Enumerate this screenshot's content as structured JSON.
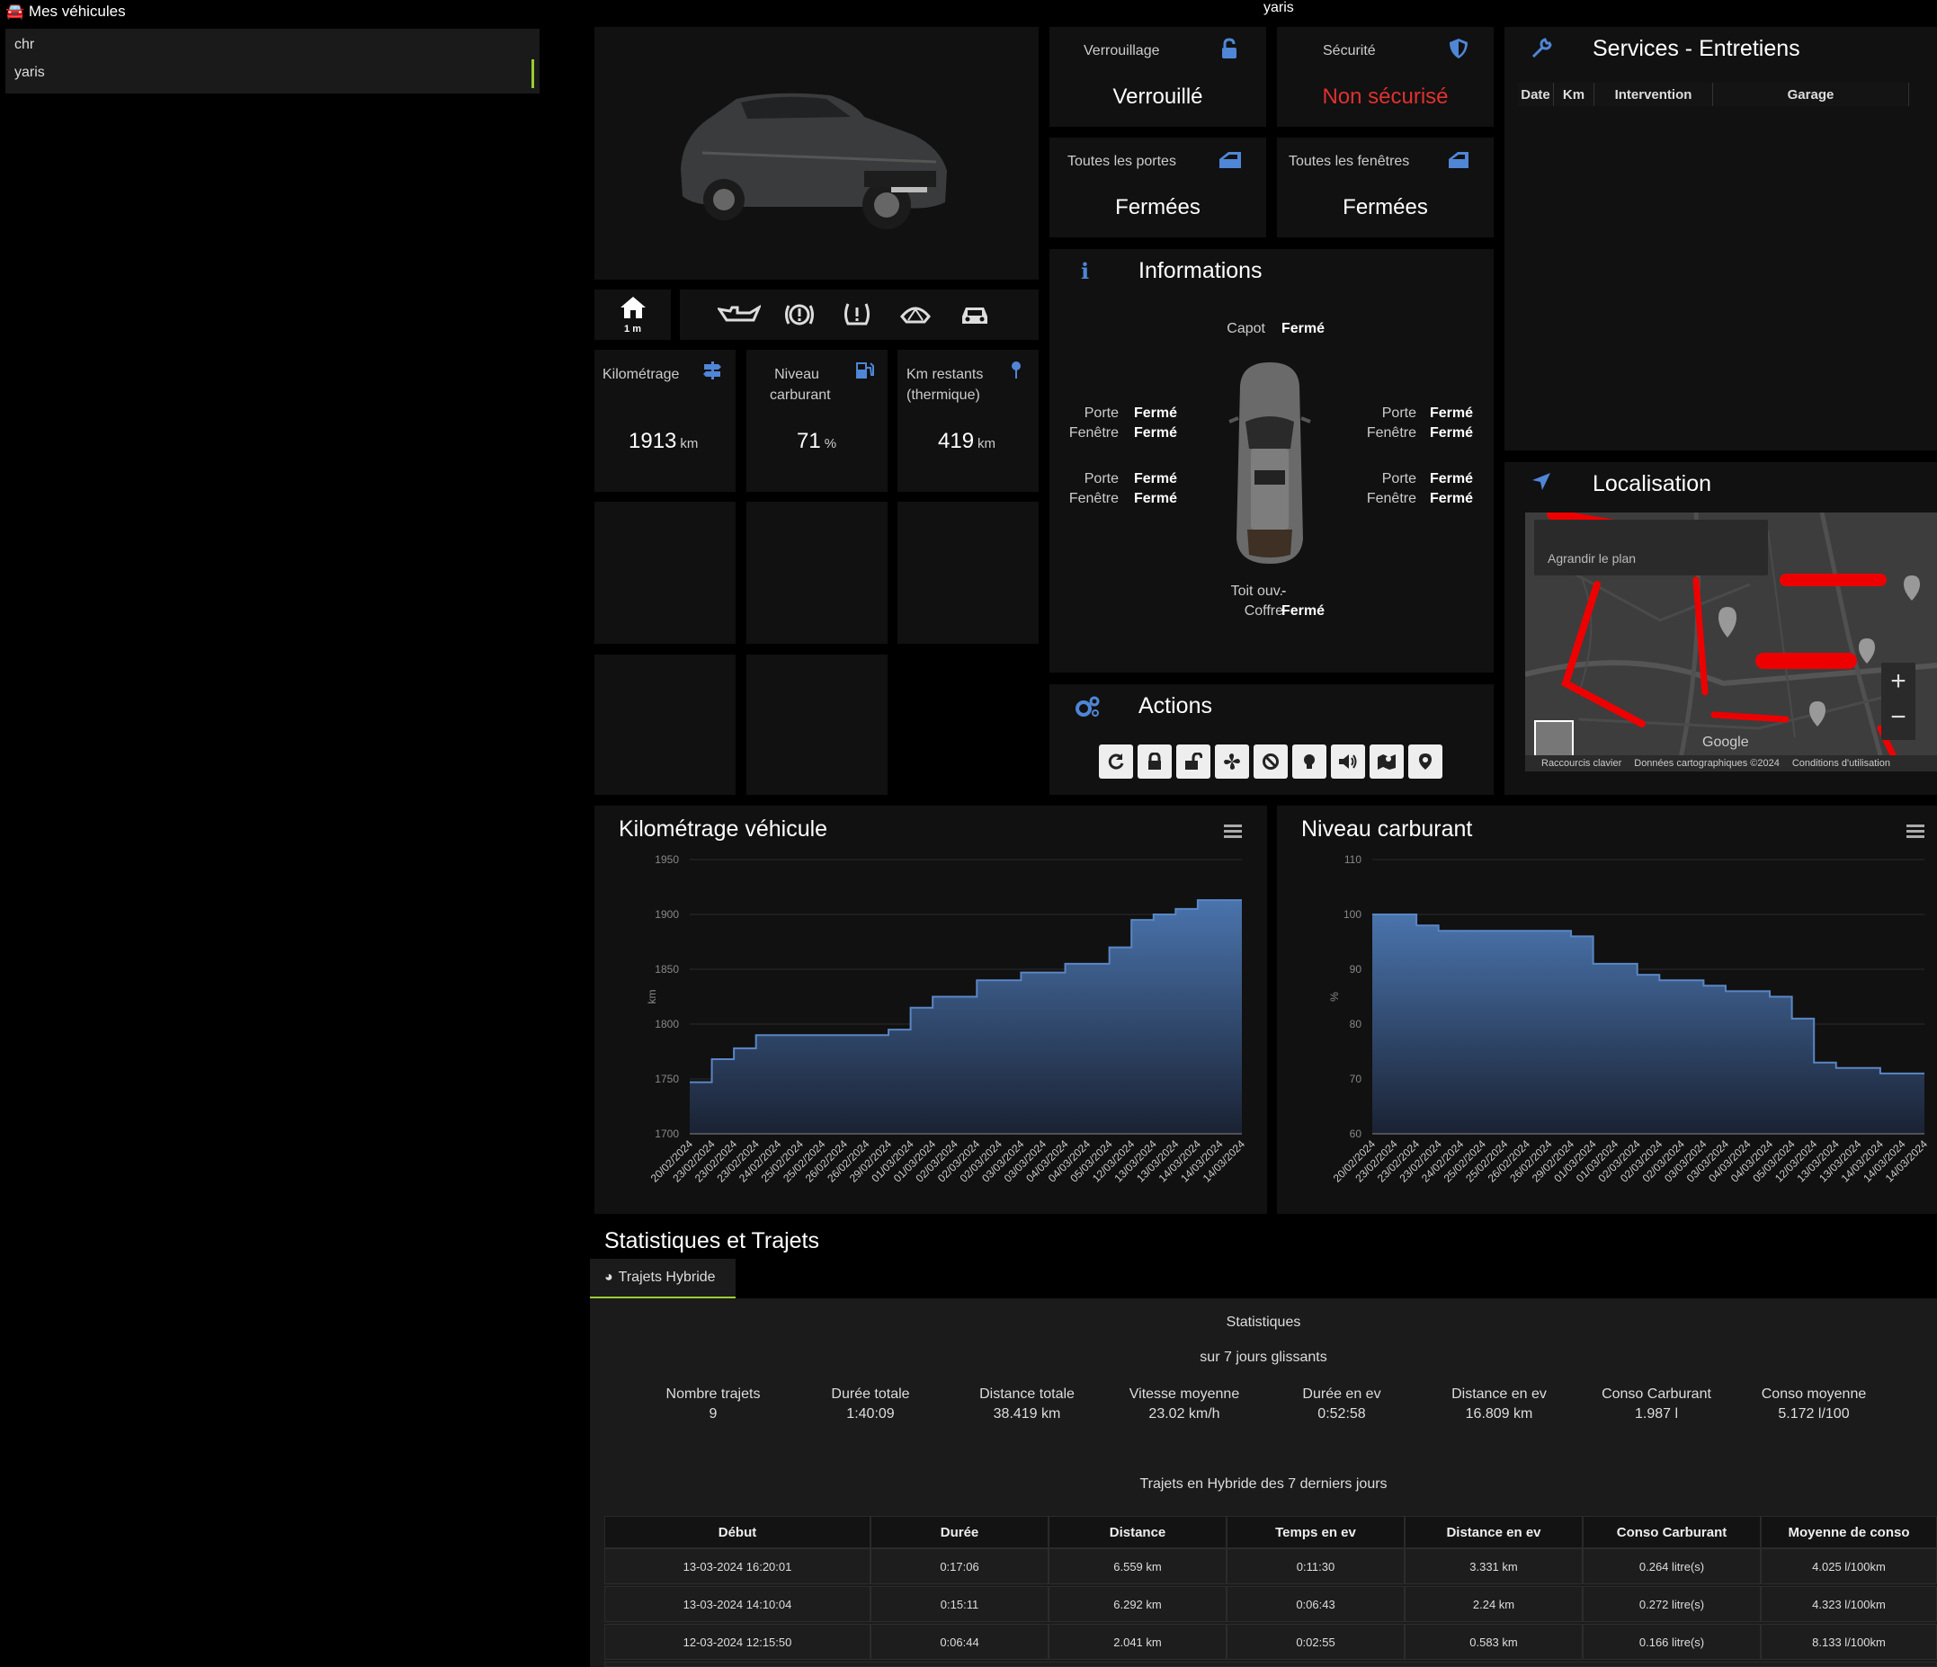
{
  "sidebar": {
    "title": "Mes véhicules",
    "items": [
      {
        "label": "chr"
      },
      {
        "label": "yaris"
      }
    ],
    "selected": "yaris"
  },
  "header": {
    "vehicle_name": "yaris"
  },
  "status": {
    "lock": {
      "title": "Verrouillage",
      "value": "Verrouillé",
      "icon": "lock-open-icon"
    },
    "security": {
      "title": "Sécurité",
      "value": "Non sécurisé",
      "icon": "shield-icon",
      "color": "#e0312f"
    },
    "doors": {
      "title": "Toutes les portes",
      "value": "Fermées",
      "icon": "car-door-icon"
    },
    "windows": {
      "title": "Toutes les fenêtres",
      "value": "Fermées",
      "icon": "car-window-icon"
    }
  },
  "location_badge": {
    "label": "1 m",
    "icon": "home-icon"
  },
  "warning_icons": [
    "oil-warning-icon",
    "brake-warning-icon",
    "tire-pressure-icon",
    "washer-fluid-icon",
    "car-icon"
  ],
  "tiles": {
    "mileage": {
      "title": "Kilométrage",
      "value": "1913",
      "unit": "km",
      "icon": "signpost-icon"
    },
    "fuel": {
      "title_line1": "Niveau",
      "title_line2": "carburant",
      "value": "71",
      "unit": "%",
      "icon": "fuel-pump-icon"
    },
    "range": {
      "title_line1": "Km restants",
      "title_line2": "(thermique)",
      "value": "419",
      "unit": "km",
      "icon": "map-pin-icon"
    }
  },
  "informations": {
    "title": "Informations",
    "hood": {
      "label": "Capot",
      "value": "Fermé"
    },
    "front_left": {
      "door_label": "Porte",
      "door_value": "Fermé",
      "window_label": "Fenêtre",
      "window_value": "Fermé"
    },
    "front_right": {
      "door_label": "Porte",
      "door_value": "Fermé",
      "window_label": "Fenêtre",
      "window_value": "Fermé"
    },
    "rear_left": {
      "door_label": "Porte",
      "door_value": "Fermé",
      "window_label": "Fenêtre",
      "window_value": "Fermé"
    },
    "rear_right": {
      "door_label": "Porte",
      "door_value": "Fermé",
      "window_label": "Fenêtre",
      "window_value": "Fermé"
    },
    "roof": {
      "label": "Toit ouv.",
      "value": "-"
    },
    "trunk": {
      "label": "Coffre",
      "value": "Fermé"
    }
  },
  "actions": {
    "title": "Actions",
    "buttons": [
      "refresh-icon",
      "lock-icon",
      "unlock-icon",
      "fan-icon",
      "ban-icon",
      "lightbulb-icon",
      "horn-icon",
      "map-icon",
      "pin-icon"
    ]
  },
  "services": {
    "title": "Services - Entretiens",
    "columns": [
      "Date",
      "Km",
      "Intervention",
      "Garage"
    ]
  },
  "localisation": {
    "title": "Localisation",
    "enlarge": "Agrandir le plan",
    "google": "Google",
    "footer": [
      "Raccourcis clavier",
      "Données cartographiques ©2024",
      "Conditions d'utilisation"
    ]
  },
  "charts": {
    "mileage": {
      "title": "Kilométrage véhicule",
      "ylabel": "km",
      "ylim": [
        1700,
        1950
      ],
      "yticks": [
        "1700",
        "1750",
        "1800",
        "1850",
        "1900",
        "1950"
      ]
    },
    "fuel": {
      "title": "Niveau carburant",
      "ylabel": "%",
      "ylim": [
        60,
        110
      ],
      "yticks": [
        "60",
        "70",
        "80",
        "90",
        "100",
        "110"
      ]
    }
  },
  "chart_data": [
    {
      "type": "area",
      "title": "Kilométrage véhicule",
      "ylabel": "km",
      "ylim": [
        1700,
        1950
      ],
      "color": "#4a74ad",
      "x": [
        "20/02/2024",
        "23/02/2024",
        "23/02/2024",
        "23/02/2024",
        "24/02/2024",
        "25/02/2024",
        "25/02/2024",
        "26/02/2024",
        "26/02/2024",
        "29/02/2024",
        "01/03/2024",
        "01/03/2024",
        "02/03/2024",
        "02/03/2024",
        "02/03/2024",
        "03/03/2024",
        "03/03/2024",
        "04/03/2024",
        "04/03/2024",
        "05/03/2024",
        "12/03/2024",
        "13/03/2024",
        "13/03/2024",
        "14/03/2024",
        "14/03/2024",
        "14/03/2024"
      ],
      "values": [
        1747,
        1768,
        1778,
        1790,
        1790,
        1790,
        1790,
        1790,
        1790,
        1795,
        1815,
        1825,
        1825,
        1840,
        1840,
        1847,
        1847,
        1855,
        1855,
        1870,
        1895,
        1900,
        1905,
        1913,
        1913,
        1913
      ]
    },
    {
      "type": "area",
      "title": "Niveau carburant",
      "ylabel": "%",
      "ylim": [
        60,
        110
      ],
      "color": "#4a74ad",
      "x": [
        "20/02/2024",
        "23/02/2024",
        "23/02/2024",
        "23/02/2024",
        "24/02/2024",
        "25/02/2024",
        "25/02/2024",
        "26/02/2024",
        "26/02/2024",
        "29/02/2024",
        "01/03/2024",
        "01/03/2024",
        "02/03/2024",
        "02/03/2024",
        "02/03/2024",
        "03/03/2024",
        "03/03/2024",
        "04/03/2024",
        "04/03/2024",
        "05/03/2024",
        "12/03/2024",
        "13/03/2024",
        "13/03/2024",
        "14/03/2024",
        "14/03/2024",
        "14/03/2024"
      ],
      "values": [
        100,
        100,
        98,
        97,
        97,
        97,
        97,
        97,
        97,
        96,
        91,
        91,
        89,
        88,
        88,
        87,
        86,
        86,
        85,
        81,
        73,
        72,
        72,
        71,
        71,
        71
      ]
    }
  ],
  "statistics": {
    "section_title": "Statistiques et Trajets",
    "tab": "Trajets Hybride",
    "heading": "Statistiques",
    "period": "sur 7 jours glissants",
    "items": [
      {
        "label": "Nombre trajets",
        "value": "9"
      },
      {
        "label": "Durée totale",
        "value": "1:40:09"
      },
      {
        "label": "Distance totale",
        "value": "38.419 km"
      },
      {
        "label": "Vitesse moyenne",
        "value": "23.02 km/h"
      },
      {
        "label": "Durée en ev",
        "value": "0:52:58"
      },
      {
        "label": "Distance en ev",
        "value": "16.809 km"
      },
      {
        "label": "Conso Carburant",
        "value": "1.987 l"
      },
      {
        "label": "Conso moyenne",
        "value": "5.172 l/100"
      }
    ],
    "trips_title": "Trajets en Hybride des 7 derniers jours",
    "columns": [
      "Début",
      "Durée",
      "Distance",
      "Temps en ev",
      "Distance en ev",
      "Conso Carburant",
      "Moyenne de conso"
    ],
    "rows": [
      [
        "13-03-2024 16:20:01",
        "0:17:06",
        "6.559 km",
        "0:11:30",
        "3.331 km",
        "0.264 litre(s)",
        "4.025 l/100km"
      ],
      [
        "13-03-2024 14:10:04",
        "0:15:11",
        "6.292 km",
        "0:06:43",
        "2.24 km",
        "0.272 litre(s)",
        "4.323 l/100km"
      ],
      [
        "12-03-2024 12:15:50",
        "0:06:44",
        "2.041 km",
        "0:02:55",
        "0.583 km",
        "0.166 litre(s)",
        "8.133 l/100km"
      ]
    ]
  }
}
